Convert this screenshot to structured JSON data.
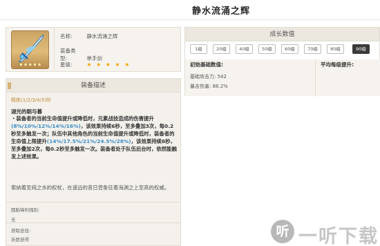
{
  "header": {
    "title": "静水流涌之辉"
  },
  "info": {
    "name_label": "名称:",
    "name_value": "静水流涌之辉",
    "type_label": "装备类型:",
    "type_value": "单手剑",
    "rarity_label": "星级:",
    "rarity_value": "★ ★ ★ ★ ★",
    "thumb_stars": "★★★★★"
  },
  "description": {
    "heading": "装备描述",
    "refinement": "精炼(1/2/3/4/5)阶",
    "passive_name": "湖光的朝与暮",
    "passive_p1": "・装备者的当前生命值提升或降低时，元素战技造成的伤害提升",
    "passive_v1": "(8%/10%/12%/14%/16%)",
    "passive_p2": "，该效果持续6秒，至多叠加3次，每0.2秒至多触发一次；队伍中其他角色的当前生命值提升或降低时，装备者的生命值上限提升",
    "passive_v2": "(14%/17.5%/21%/24.5%/28%)",
    "passive_p3": "，该效果持续6秒，至多叠加2次，每0.2秒至多触发一次。装备者处于队伍后台时，依然能触发上述效果。",
    "lore": "索纳着至纯之水的权杖，在遥远的昔日曾象征着海渊之上至高的权威。",
    "breakthrough_label": "圆胎锋利强别:",
    "breakthrough_value": "无",
    "source_label": "获取途径:",
    "source_value": "祈愿获得"
  },
  "growth": {
    "heading": "成长数值",
    "levels": [
      "1级",
      "20级",
      "40级",
      "50级",
      "60级",
      "70级",
      "80级",
      "90级"
    ],
    "active_level": "90级",
    "base_header": "初始基础数值:",
    "avg_header": "平均每级提升:",
    "atk_line": "基础攻击力: 542",
    "crit_line": "暴击伤害: 88.2%"
  },
  "watermark": {
    "icon_glyph": "听",
    "text": "一听下载"
  }
}
